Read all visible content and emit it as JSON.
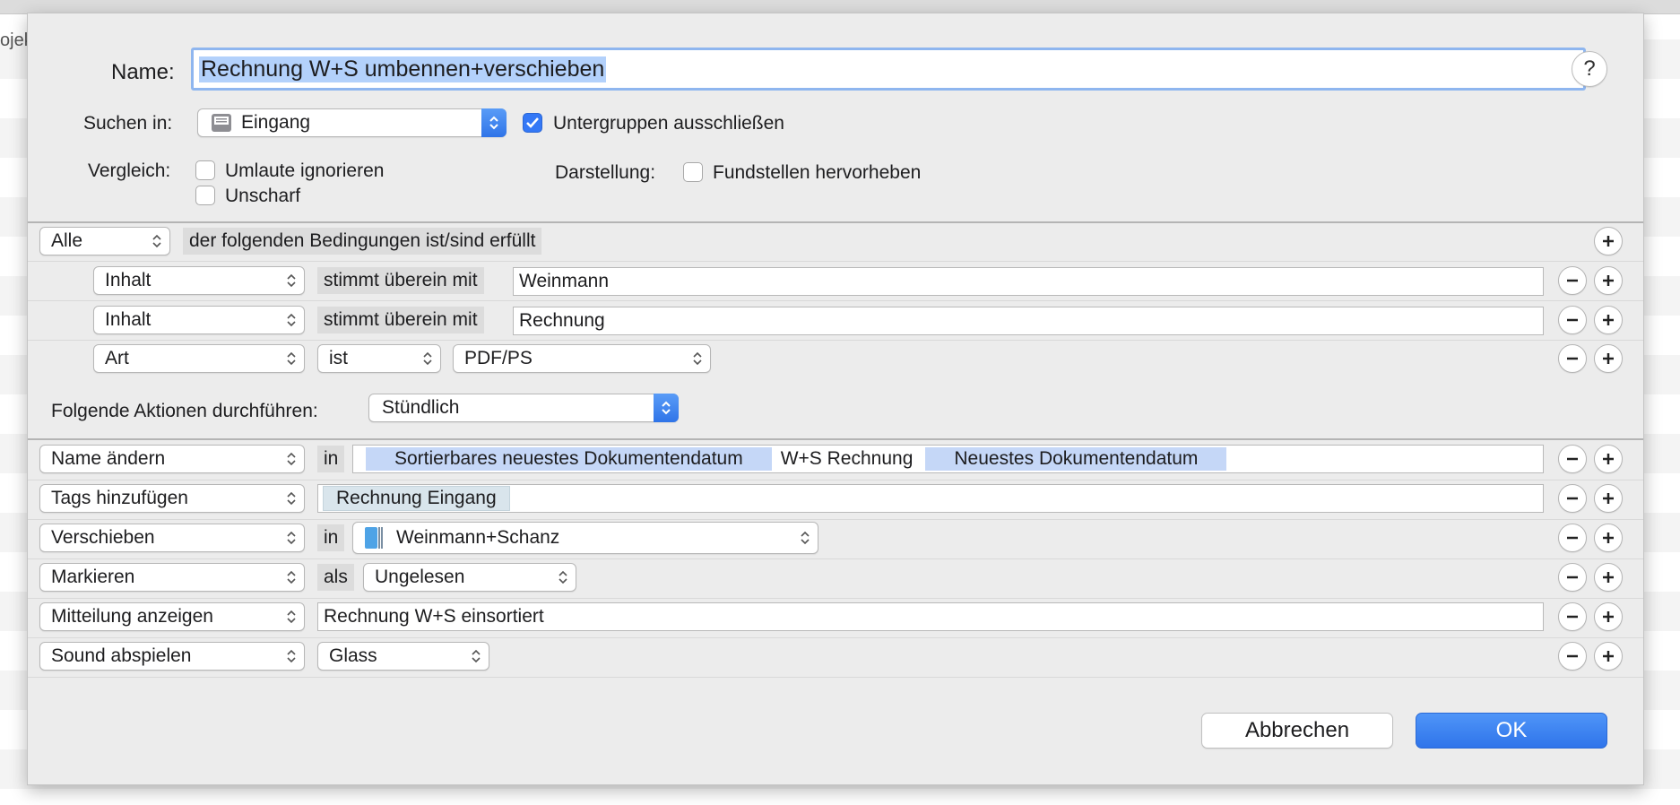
{
  "background": {
    "partial_label": "ojek"
  },
  "header": {
    "name_label": "Name:",
    "name_value": "Rechnung W+S umbennen+verschieben",
    "help": "?",
    "search_in_label": "Suchen in:",
    "search_in_value": "Eingang",
    "exclude_subgroups_label": "Untergruppen ausschließen",
    "compare_label": "Vergleich:",
    "ignore_umlauts_label": "Umlaute ignorieren",
    "fuzzy_label": "Unscharf",
    "display_label": "Darstellung:",
    "highlight_label": "Fundstellen hervorheben"
  },
  "conditions": {
    "match_mode": "Alle",
    "match_text": "der folgenden Bedingungen ist/sind erfüllt",
    "rows": [
      {
        "field": "Inhalt",
        "operator": "stimmt überein mit",
        "value": "Weinmann"
      },
      {
        "field": "Inhalt",
        "operator": "stimmt überein mit",
        "value": "Rechnung"
      },
      {
        "field": "Art",
        "operator": "ist",
        "value": "PDF/PS"
      }
    ]
  },
  "schedule": {
    "label": "Folgende Aktionen durchführen:",
    "value": "Stündlich"
  },
  "actions": {
    "rename": {
      "action": "Name ändern",
      "prep": "in",
      "token1": "Sortierbares neuestes Dokumentendatum",
      "text": "W+S Rechnung",
      "token2": "Neuestes Dokumentendatum"
    },
    "tags": {
      "action": "Tags hinzufügen",
      "tag": "Rechnung Eingang"
    },
    "move": {
      "action": "Verschieben",
      "prep": "in",
      "target": "Weinmann+Schanz"
    },
    "mark": {
      "action": "Markieren",
      "prep": "als",
      "value": "Ungelesen"
    },
    "notify": {
      "action": "Mitteilung anzeigen",
      "message": "Rechnung W+S einsortiert"
    },
    "sound": {
      "action": "Sound abspielen",
      "value": "Glass"
    }
  },
  "buttons": {
    "cancel": "Abbrechen",
    "ok": "OK"
  },
  "colors": {
    "accent": "#3478f6",
    "token": "#c5d7f7",
    "sheet": "#ececec"
  }
}
